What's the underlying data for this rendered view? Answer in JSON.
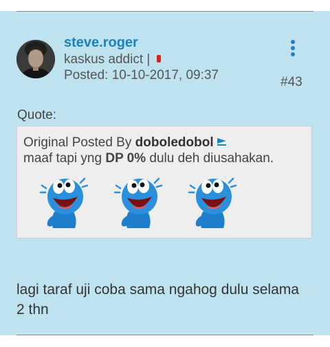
{
  "post": {
    "username": "steve.roger",
    "rank": "kaskus addict |",
    "posted": "Posted: 10-10-2017, 09:37",
    "post_number": "#43",
    "quote_label": "Quote:",
    "quote": {
      "prefix": "Original Posted By ",
      "author": "doboledobol",
      "text_before": "maaf tapi yng ",
      "text_bold": "DP 0%",
      "text_after": " dulu deh diusahakan."
    },
    "body": "lagi taraf uji coba sama ngahog dulu selama 2 thn"
  },
  "icons": {
    "menu": "more-vertical-icon",
    "status": "status-indicator-icon",
    "view_post": "view-post-arrow-icon",
    "emoticon": "laughing-emoticon-icon"
  },
  "colors": {
    "post_background": "#bfe3ee",
    "username": "#1a82c4",
    "status_dot": "#d9231b",
    "quote_background": "#eeeeee"
  }
}
